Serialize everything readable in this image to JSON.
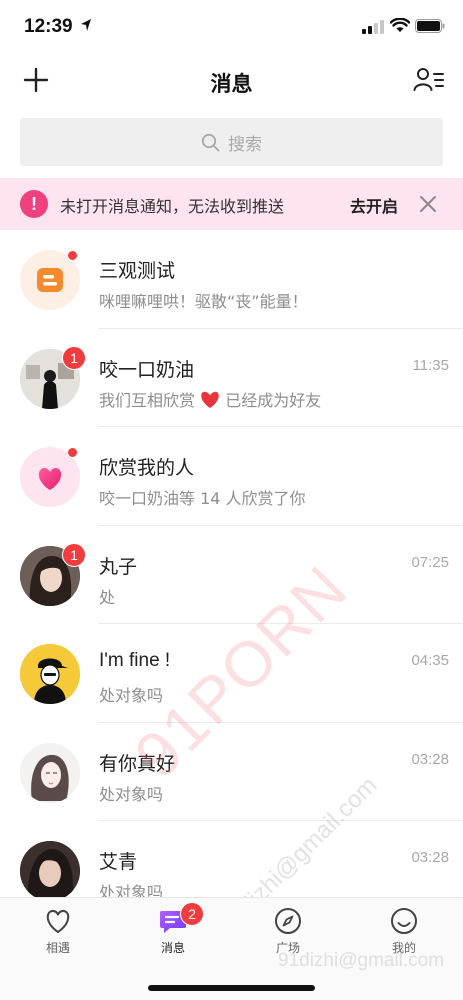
{
  "status_bar": {
    "time": "12:39"
  },
  "nav": {
    "title": "消息"
  },
  "search": {
    "placeholder": "搜索"
  },
  "notice": {
    "text": "未打开消息通知，无法收到推送",
    "action": "去开启"
  },
  "messages": [
    {
      "name": "三观测试",
      "preview": "咪哩嘛哩哄！驱散“丧”能量！",
      "time": "",
      "badge": "",
      "dot": true
    },
    {
      "name": "咬一口奶油",
      "preview": "我们互相欣赏",
      "preview_suffix": "已经成为好友",
      "time": "11:35",
      "badge": "1",
      "dot": false
    },
    {
      "name": "欣赏我的人",
      "preview": "咬一口奶油等 14 人欣赏了你",
      "time": "",
      "badge": "",
      "dot": true
    },
    {
      "name": "丸子",
      "preview": "处",
      "time": "07:25",
      "badge": "1",
      "dot": false
    },
    {
      "name": "I'm fine !",
      "preview": "处对象吗",
      "time": "04:35",
      "badge": "",
      "dot": false
    },
    {
      "name": "有你真好",
      "preview": "处对象吗",
      "time": "03:28",
      "badge": "",
      "dot": false
    },
    {
      "name": "艾青",
      "preview": "处对象吗",
      "time": "03:28",
      "badge": "",
      "dot": false
    }
  ],
  "tabs": [
    {
      "label": "相遇",
      "icon": "heart-icon"
    },
    {
      "label": "消息",
      "icon": "chat-icon",
      "badge": "2",
      "active": true
    },
    {
      "label": "广场",
      "icon": "compass-icon"
    },
    {
      "label": "我的",
      "icon": "smile-icon"
    }
  ],
  "watermark": {
    "text": "91PORN",
    "email": "91dizhi@gmail.com",
    "email2": "91dizhi@gmail.com"
  },
  "colors": {
    "accent": "#f0407e",
    "badge": "#f03c3c",
    "notice_bg": "#fde4ee",
    "tab_active": "#8a4dff"
  }
}
